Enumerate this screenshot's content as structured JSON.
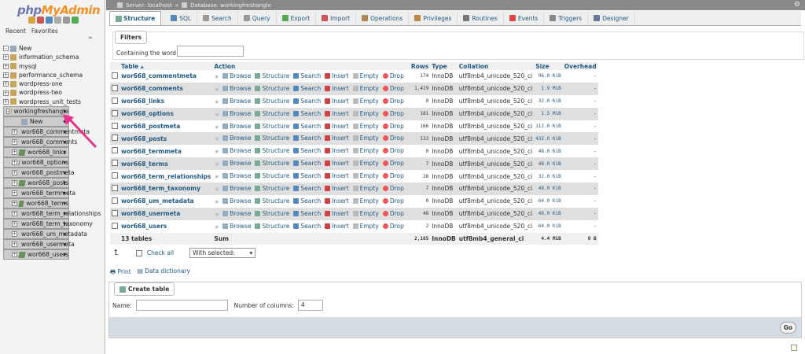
{
  "app": {
    "logo_php": "php",
    "logo_my": "MyAdmin",
    "recent": "Recent",
    "favorites": "Favorites"
  },
  "nav": {
    "new": "New",
    "databases": [
      "information_schema",
      "mysql",
      "performance_schema",
      "wordpress-one",
      "wordpress-two",
      "wordpress_unit_tests",
      "workingfreshangle"
    ],
    "selected_db": "workingfreshangle",
    "tables": [
      "New",
      "wor668_commentmeta",
      "wor668_comments",
      "wor668_links",
      "wor668_options",
      "wor668_postmeta",
      "wor668_posts",
      "wor668_termmeta",
      "wor668_terms",
      "wor668_term_relationships",
      "wor668_term_taxonomy",
      "wor668_um_metadata",
      "wor668_usermeta",
      "wor668_users"
    ]
  },
  "breadcrumb": {
    "server": "Server: localhost",
    "sep": "»",
    "database": "Database: workingfreshangle"
  },
  "tabs": [
    "Structure",
    "SQL",
    "Search",
    "Query",
    "Export",
    "Import",
    "Operations",
    "Privileges",
    "Routines",
    "Events",
    "Triggers",
    "Designer"
  ],
  "filters": {
    "title": "Filters",
    "label": "Containing the word:"
  },
  "table_headers": {
    "table": "Table",
    "action": "Action",
    "rows": "Rows",
    "type": "Type",
    "collation": "Collation",
    "size": "Size",
    "overhead": "Overhead"
  },
  "actions": [
    "Browse",
    "Structure",
    "Search",
    "Insert",
    "Empty",
    "Drop"
  ],
  "rows": [
    {
      "name": "wor668_commentmeta",
      "rows": "174",
      "type": "InnoDB",
      "collation": "utf8mb4_unicode_520_ci",
      "size": "96.0 KiB",
      "overhead": "-"
    },
    {
      "name": "wor668_comments",
      "rows": "1,419",
      "type": "InnoDB",
      "collation": "utf8mb4_unicode_520_ci",
      "size": "1.9 MiB",
      "overhead": "-"
    },
    {
      "name": "wor668_links",
      "rows": "0",
      "type": "InnoDB",
      "collation": "utf8mb4_unicode_520_ci",
      "size": "32.0 KiB",
      "overhead": "-"
    },
    {
      "name": "wor668_options",
      "rows": "181",
      "type": "InnoDB",
      "collation": "utf8mb4_unicode_520_ci",
      "size": "1.5 MiB",
      "overhead": "-"
    },
    {
      "name": "wor668_postmeta",
      "rows": "166",
      "type": "InnoDB",
      "collation": "utf8mb4_unicode_520_ci",
      "size": "112.0 KiB",
      "overhead": "-"
    },
    {
      "name": "wor668_posts",
      "rows": "133",
      "type": "InnoDB",
      "collation": "utf8mb4_unicode_520_ci",
      "size": "432.0 KiB",
      "overhead": "-"
    },
    {
      "name": "wor668_termmeta",
      "rows": "0",
      "type": "InnoDB",
      "collation": "utf8mb4_unicode_520_ci",
      "size": "48.0 KiB",
      "overhead": "-"
    },
    {
      "name": "wor668_terms",
      "rows": "7",
      "type": "InnoDB",
      "collation": "utf8mb4_unicode_520_ci",
      "size": "48.0 KiB",
      "overhead": "-"
    },
    {
      "name": "wor668_term_relationships",
      "rows": "28",
      "type": "InnoDB",
      "collation": "utf8mb4_unicode_520_ci",
      "size": "32.0 KiB",
      "overhead": "-"
    },
    {
      "name": "wor668_term_taxonomy",
      "rows": "7",
      "type": "InnoDB",
      "collation": "utf8mb4_unicode_520_ci",
      "size": "48.0 KiB",
      "overhead": "-"
    },
    {
      "name": "wor668_um_metadata",
      "rows": "0",
      "type": "InnoDB",
      "collation": "utf8mb4_unicode_520_ci",
      "size": "64.0 KiB",
      "overhead": "-"
    },
    {
      "name": "wor668_usermeta",
      "rows": "48",
      "type": "InnoDB",
      "collation": "utf8mb4_unicode_520_ci",
      "size": "48.0 KiB",
      "overhead": "-"
    },
    {
      "name": "wor668_users",
      "rows": "2",
      "type": "InnoDB",
      "collation": "utf8mb4_unicode_520_ci",
      "size": "64.0 KiB",
      "overhead": "-"
    }
  ],
  "summary": {
    "tables": "13 tables",
    "sum": "Sum",
    "rows": "2,165",
    "type": "InnoDB",
    "collation": "utf8mb4_general_ci",
    "size": "4.4 MiB",
    "overhead": "0 B"
  },
  "bulk": {
    "check_all": "Check all",
    "with_selected": "With selected:"
  },
  "links": {
    "print": "Print",
    "dictionary": "Data dictionary"
  },
  "create": {
    "title": "Create table",
    "name_label": "Name:",
    "cols_label": "Number of columns:",
    "cols_value": "4",
    "go": "Go"
  },
  "colors": {
    "link": "#235a81",
    "arrow": "#e6338a"
  }
}
